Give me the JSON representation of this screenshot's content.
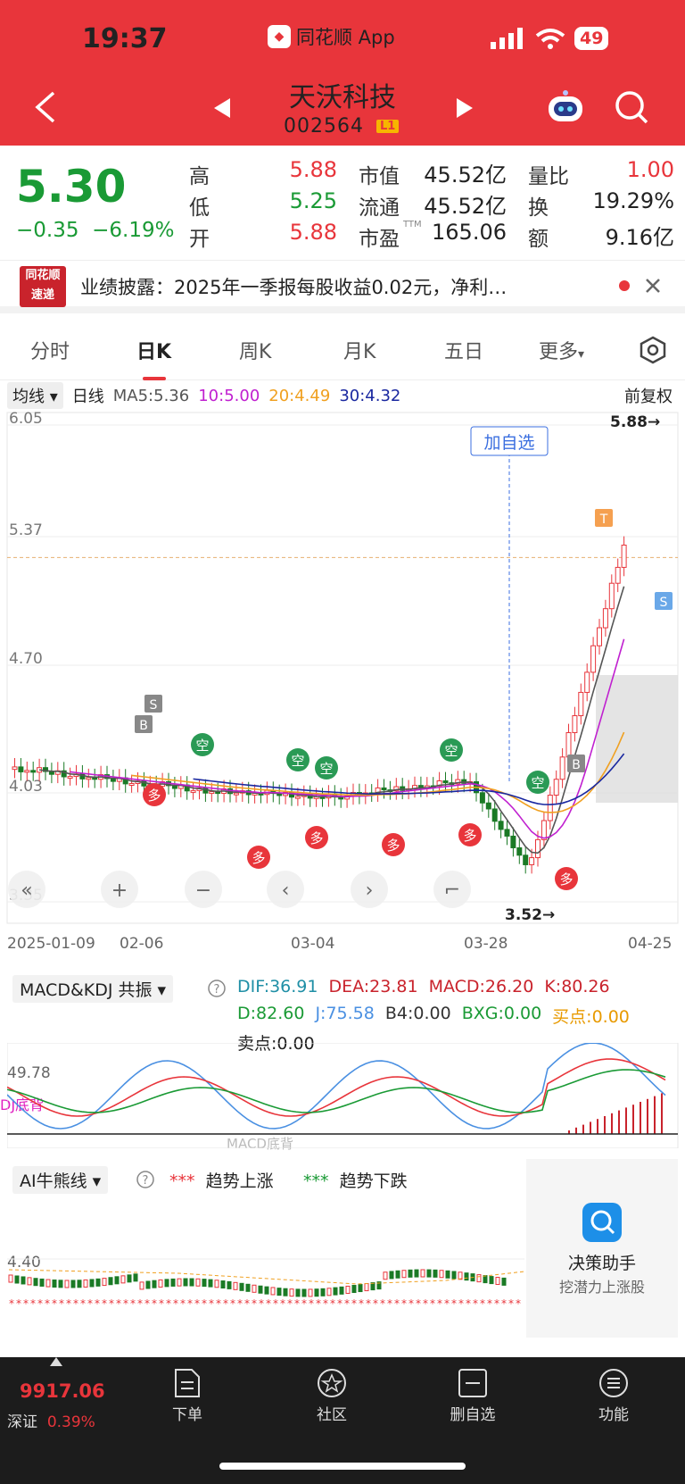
{
  "status": {
    "time": "19:37",
    "app": "同花顺 App",
    "battery": "49"
  },
  "stock": {
    "name": "天沃科技",
    "code": "002564",
    "level": "L1"
  },
  "quote": {
    "price": "5.30",
    "change": "−0.35",
    "pct": "−6.19%",
    "cells": [
      [
        "高",
        "5.88",
        "red"
      ],
      [
        "低",
        "5.25",
        "green"
      ],
      [
        "开",
        "5.88",
        "red"
      ]
    ],
    "cells2": [
      [
        "市值",
        "45.52亿"
      ],
      [
        "流通",
        "45.52亿"
      ],
      [
        "市盈",
        "165.06"
      ]
    ],
    "ttm": "TTM",
    "cells3": [
      [
        "量比",
        "1.00",
        "red"
      ],
      [
        "换",
        "19.29%",
        ""
      ],
      [
        "额",
        "9.16亿",
        ""
      ]
    ]
  },
  "news": {
    "logo1": "同花顺",
    "logo2": "速递",
    "text": "业绩披露：2025年一季报每股收益0.02元，净利…"
  },
  "tabs": [
    "分时",
    "日K",
    "周K",
    "月K",
    "五日",
    "更多"
  ],
  "ma": {
    "sel": "均线",
    "period": "日线",
    "ma5": "MA5:5.36",
    "ma10": "10:5.00",
    "ma20": "20:4.49",
    "ma30": "30:4.32",
    "adj": "前复权"
  },
  "kline": {
    "y_labels": [
      "6.05",
      "5.37",
      "4.70",
      "4.03",
      "3.35"
    ],
    "high_label": "5.88→",
    "low_label": "3.52→",
    "add_label": "加自选",
    "dates": [
      "2025-01-09",
      "02-06",
      "03-04",
      "03-28",
      "04-25"
    ]
  },
  "macd": {
    "sel": "MACD&KDJ 共振",
    "l1": [
      [
        "DIF:36.91",
        "#1f8fa6"
      ],
      [
        "DEA:23.81",
        "#c9232c"
      ],
      [
        "MACD:26.20",
        "#c9232c"
      ],
      [
        "K:80.26",
        "#c9232c"
      ]
    ],
    "l2": [
      [
        "D:82.60",
        "#1a9a35"
      ],
      [
        "J:75.58",
        "#4a90e2"
      ],
      [
        "B4:0.00",
        "#333"
      ],
      [
        "BXG:0.00",
        "#1a9a35"
      ],
      [
        "买点:0.00",
        "#e89a00"
      ]
    ],
    "l3": "卖点:0.00",
    "y": "49.78",
    "side": "DJ底背",
    "bottom": "MACD底背"
  },
  "ai": {
    "sel": "AI牛熊线",
    "up": "趋势上涨",
    "down": "趋势下跌",
    "y": "4.40",
    "helper": "决策助手",
    "helper_sub": "挖潜力上涨股"
  },
  "footer": {
    "index": "9917.06",
    "market": "深证",
    "pct": "0.39%",
    "items": [
      "下单",
      "社区",
      "删自选",
      "功能"
    ]
  },
  "colors": {
    "brand": "#e8353b",
    "up": "#e8353b",
    "down": "#1a9a35"
  }
}
